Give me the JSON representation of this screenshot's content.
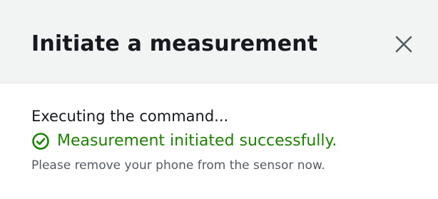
{
  "dialog": {
    "title": "Initiate a measurement",
    "close_icon": "close-icon",
    "status_text": "Executing the command...",
    "success_icon": "check-circle-icon",
    "success_text": "Measurement initiated successfully.",
    "hint_text": "Please remove your phone from the sensor now."
  },
  "colors": {
    "header_bg": "#f2f3f3",
    "success": "#1d8102",
    "text": "#16191f",
    "secondary_text": "#545b64"
  }
}
